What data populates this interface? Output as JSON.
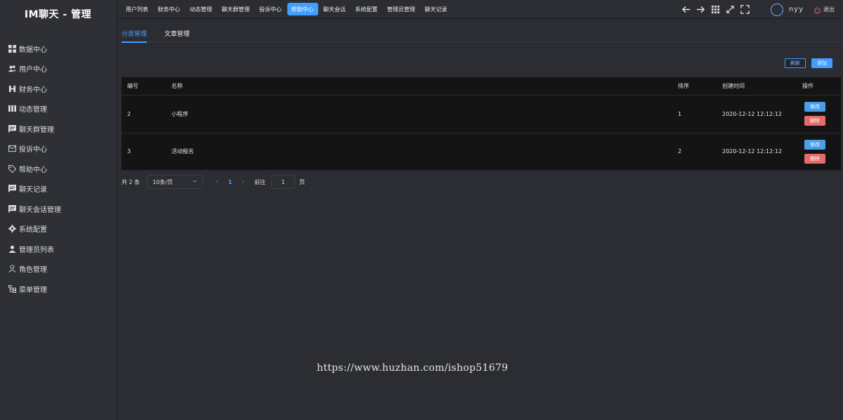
{
  "app": {
    "title": "IM聊天 - 管理"
  },
  "sidebar": {
    "items": [
      {
        "label": "数据中心",
        "icon": "dashboard-icon"
      },
      {
        "label": "用户中心",
        "icon": "users-icon"
      },
      {
        "label": "财务中心",
        "icon": "finance-icon"
      },
      {
        "label": "动态管理",
        "icon": "moments-icon"
      },
      {
        "label": "聊天群管理",
        "icon": "chat-group-icon"
      },
      {
        "label": "投诉中心",
        "icon": "mail-icon"
      },
      {
        "label": "帮助中心",
        "icon": "tag-icon"
      },
      {
        "label": "聊天记录",
        "icon": "chat-record-icon"
      },
      {
        "label": "聊天会话管理",
        "icon": "chat-session-icon"
      },
      {
        "label": "系统配置",
        "icon": "gear-icon"
      },
      {
        "label": "管理员列表",
        "icon": "admin-icon"
      },
      {
        "label": "角色管理",
        "icon": "role-icon"
      },
      {
        "label": "菜单管理",
        "icon": "menu-tree-icon"
      }
    ]
  },
  "topnav": {
    "items": [
      "用户列表",
      "财务中心",
      "动态管理",
      "聊天群管理",
      "投诉中心",
      "帮助中心",
      "聊天会话",
      "系统配置",
      "管理员管理",
      "聊天记录"
    ],
    "active_index": 5
  },
  "user": {
    "name": "nyy",
    "logout": "退出"
  },
  "tabs": {
    "category": "分类管理",
    "article": "文章管理"
  },
  "actions": {
    "refresh": "刷新",
    "add": "添加"
  },
  "table": {
    "headers": {
      "id": "编号",
      "name": "名称",
      "sort": "排序",
      "created": "创建时间",
      "op": "操作"
    },
    "rows": [
      {
        "id": "2",
        "name": "小程序",
        "sort": "1",
        "created": "2020-12-12 12:12:12"
      },
      {
        "id": "3",
        "name": "活动报名",
        "sort": "2",
        "created": "2020-12-12 12:12:12"
      }
    ],
    "edit_label": "修改",
    "delete_label": "删除"
  },
  "pagination": {
    "total": "共 2 条",
    "page_size": "10条/页",
    "current": "1",
    "goto_label": "前往",
    "goto_value": "1",
    "page_unit": "页"
  },
  "watermark": "https://www.huzhan.com/ishop51679",
  "colors": {
    "accent": "#409eff",
    "danger": "#e66b6b",
    "bg": "#2b2d33",
    "sidebar": "#2e3035"
  }
}
